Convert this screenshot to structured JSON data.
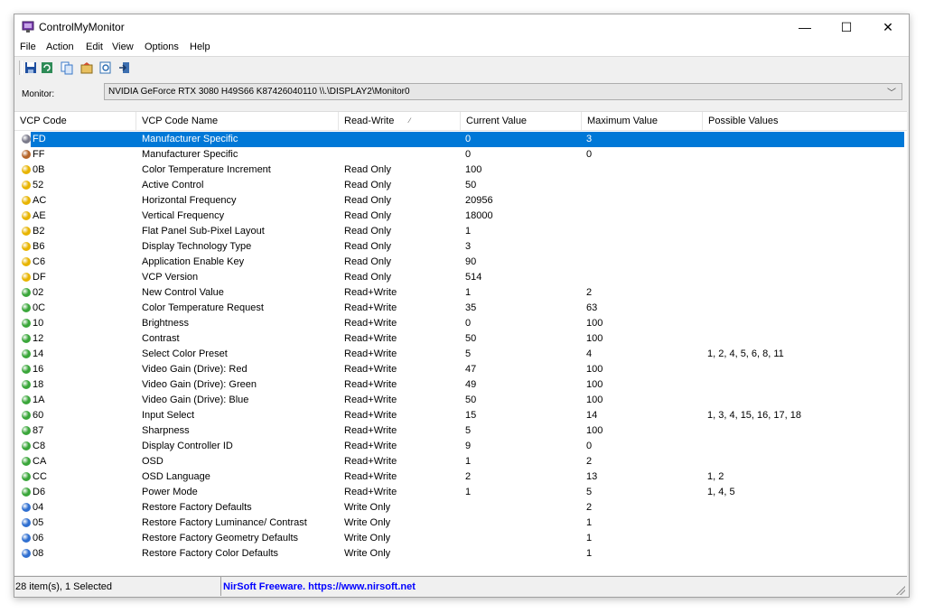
{
  "window": {
    "title": "ControlMyMonitor",
    "min_glyph": "—",
    "max_glyph": "☐",
    "close_glyph": "✕"
  },
  "menu": [
    "File",
    "Action",
    "Edit",
    "View",
    "Options",
    "Help"
  ],
  "toolbar": [
    {
      "icon": "save-icon",
      "color": "#1f4fa0"
    },
    {
      "icon": "refresh-icon",
      "color": "#2e8b57"
    },
    {
      "icon": "copy-icon",
      "color": "#3a78c8"
    },
    {
      "icon": "properties-icon",
      "color": "#b08a2a"
    },
    {
      "icon": "find-icon",
      "color": "#2f6fb3"
    },
    {
      "icon": "exit-icon",
      "color": "#3d6fb0"
    }
  ],
  "monitor": {
    "label": "Monitor:",
    "value": "NVIDIA GeForce RTX 3080  H49S66  K87426040110  \\\\.\\DISPLAY2\\Monitor0",
    "chevron": "﹀"
  },
  "columns": [
    "VCP Code",
    "VCP Code Name",
    "Read-Write",
    "Current Value",
    "Maximum Value",
    "Possible Values"
  ],
  "sort_indicator": "∕",
  "rows": [
    {
      "code": "FD",
      "name": "Manufacturer Specific",
      "rw": "",
      "cur": "0",
      "max": "3",
      "possible": "",
      "status": "gray",
      "selected": true
    },
    {
      "code": "FF",
      "name": "Manufacturer Specific",
      "rw": "",
      "cur": "0",
      "max": "0",
      "possible": "",
      "status": "brown"
    },
    {
      "code": "0B",
      "name": "Color Temperature Increment",
      "rw": "Read Only",
      "cur": "100",
      "max": "",
      "possible": "",
      "status": "yellow"
    },
    {
      "code": "52",
      "name": "Active Control",
      "rw": "Read Only",
      "cur": "50",
      "max": "",
      "possible": "",
      "status": "yellow"
    },
    {
      "code": "AC",
      "name": "Horizontal Frequency",
      "rw": "Read Only",
      "cur": "20956",
      "max": "",
      "possible": "",
      "status": "yellow"
    },
    {
      "code": "AE",
      "name": "Vertical Frequency",
      "rw": "Read Only",
      "cur": "18000",
      "max": "",
      "possible": "",
      "status": "yellow"
    },
    {
      "code": "B2",
      "name": "Flat Panel Sub-Pixel Layout",
      "rw": "Read Only",
      "cur": "1",
      "max": "",
      "possible": "",
      "status": "yellow"
    },
    {
      "code": "B6",
      "name": "Display Technology Type",
      "rw": "Read Only",
      "cur": "3",
      "max": "",
      "possible": "",
      "status": "yellow"
    },
    {
      "code": "C6",
      "name": "Application Enable Key",
      "rw": "Read Only",
      "cur": "90",
      "max": "",
      "possible": "",
      "status": "yellow"
    },
    {
      "code": "DF",
      "name": "VCP Version",
      "rw": "Read Only",
      "cur": "514",
      "max": "",
      "possible": "",
      "status": "yellow"
    },
    {
      "code": "02",
      "name": "New Control Value",
      "rw": "Read+Write",
      "cur": "1",
      "max": "2",
      "possible": "",
      "status": "green"
    },
    {
      "code": "0C",
      "name": "Color Temperature Request",
      "rw": "Read+Write",
      "cur": "35",
      "max": "63",
      "possible": "",
      "status": "green"
    },
    {
      "code": "10",
      "name": "Brightness",
      "rw": "Read+Write",
      "cur": "0",
      "max": "100",
      "possible": "",
      "status": "green"
    },
    {
      "code": "12",
      "name": "Contrast",
      "rw": "Read+Write",
      "cur": "50",
      "max": "100",
      "possible": "",
      "status": "green"
    },
    {
      "code": "14",
      "name": "Select Color Preset",
      "rw": "Read+Write",
      "cur": "5",
      "max": "4",
      "possible": "1, 2, 4, 5, 6, 8, 11",
      "status": "green"
    },
    {
      "code": "16",
      "name": "Video Gain (Drive): Red",
      "rw": "Read+Write",
      "cur": "47",
      "max": "100",
      "possible": "",
      "status": "green"
    },
    {
      "code": "18",
      "name": "Video Gain (Drive): Green",
      "rw": "Read+Write",
      "cur": "49",
      "max": "100",
      "possible": "",
      "status": "green"
    },
    {
      "code": "1A",
      "name": "Video Gain (Drive): Blue",
      "rw": "Read+Write",
      "cur": "50",
      "max": "100",
      "possible": "",
      "status": "green"
    },
    {
      "code": "60",
      "name": "Input Select",
      "rw": "Read+Write",
      "cur": "15",
      "max": "14",
      "possible": "1, 3, 4, 15, 16, 17, 18",
      "status": "green"
    },
    {
      "code": "87",
      "name": "Sharpness",
      "rw": "Read+Write",
      "cur": "5",
      "max": "100",
      "possible": "",
      "status": "green"
    },
    {
      "code": "C8",
      "name": "Display Controller ID",
      "rw": "Read+Write",
      "cur": "9",
      "max": "0",
      "possible": "",
      "status": "green"
    },
    {
      "code": "CA",
      "name": "OSD",
      "rw": "Read+Write",
      "cur": "1",
      "max": "2",
      "possible": "",
      "status": "green"
    },
    {
      "code": "CC",
      "name": "OSD Language",
      "rw": "Read+Write",
      "cur": "2",
      "max": "13",
      "possible": "1, 2",
      "status": "green"
    },
    {
      "code": "D6",
      "name": "Power Mode",
      "rw": "Read+Write",
      "cur": "1",
      "max": "5",
      "possible": "1, 4, 5",
      "status": "green"
    },
    {
      "code": "04",
      "name": "Restore Factory Defaults",
      "rw": "Write Only",
      "cur": "",
      "max": "2",
      "possible": "",
      "status": "blue"
    },
    {
      "code": "05",
      "name": "Restore Factory Luminance/ Contrast",
      "rw": "Write Only",
      "cur": "",
      "max": "1",
      "possible": "",
      "status": "blue"
    },
    {
      "code": "06",
      "name": "Restore Factory Geometry Defaults",
      "rw": "Write Only",
      "cur": "",
      "max": "1",
      "possible": "",
      "status": "blue"
    },
    {
      "code": "08",
      "name": "Restore Factory Color Defaults",
      "rw": "Write Only",
      "cur": "",
      "max": "1",
      "possible": "",
      "status": "blue"
    }
  ],
  "status_colors": {
    "gray": "#7a7a8a",
    "brown": "#b5652a",
    "yellow": "#e8b400",
    "green": "#3aa63a",
    "blue": "#2f6fd0"
  },
  "selection_color": "#0078d7",
  "statusbar": {
    "count": "28 item(s), 1 Selected",
    "credit": "NirSoft Freeware. https://www.nirsoft.net"
  }
}
